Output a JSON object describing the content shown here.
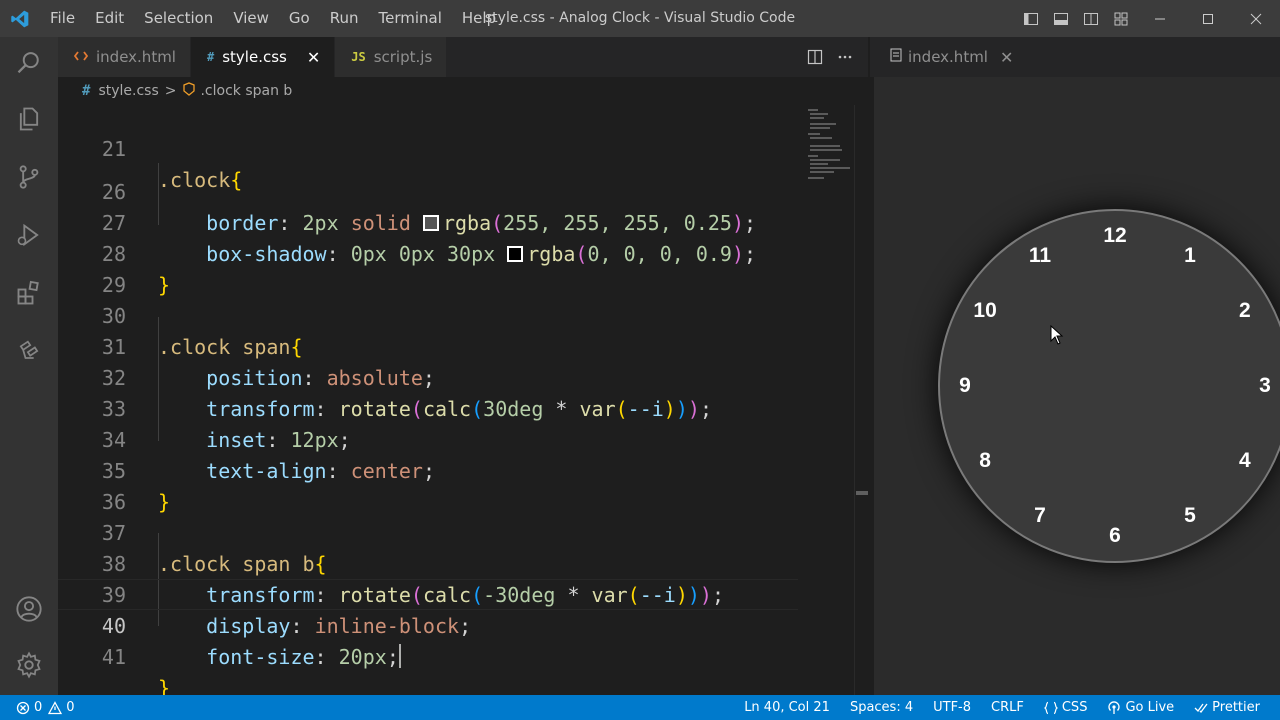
{
  "window": {
    "title": "style.css - Analog Clock - Visual Studio Code"
  },
  "menu": [
    "File",
    "Edit",
    "Selection",
    "View",
    "Go",
    "Run",
    "Terminal",
    "Help"
  ],
  "tabs": [
    {
      "label": "index.html",
      "icon": "html-file-icon",
      "active": false
    },
    {
      "label": "style.css",
      "icon": "css-file-icon",
      "active": true
    },
    {
      "label": "script.js",
      "icon": "js-file-icon",
      "active": false
    }
  ],
  "tab_icons": {
    "css": "#",
    "js": "JS"
  },
  "breadcrumb": {
    "file": "style.css",
    "separator": ">",
    "symbol": ".clock span b"
  },
  "editor": {
    "lines": [
      {
        "n": "21",
        "text": ".clock{"
      },
      {
        "n": "26",
        "text": "border: 2px solid rgba(255, 255, 255, 0.25);"
      },
      {
        "n": "27",
        "text": "box-shadow: 0px 0px 30px rgba(0, 0, 0, 0.9);"
      },
      {
        "n": "28",
        "text": "}"
      },
      {
        "n": "29",
        "text": ""
      },
      {
        "n": "30",
        "text": ".clock span{"
      },
      {
        "n": "31",
        "text": "position: absolute;"
      },
      {
        "n": "32",
        "text": "transform: rotate(calc(30deg * var(--i)));"
      },
      {
        "n": "33",
        "text": "inset: 12px;"
      },
      {
        "n": "34",
        "text": "text-align: center;"
      },
      {
        "n": "35",
        "text": "}"
      },
      {
        "n": "36",
        "text": ""
      },
      {
        "n": "37",
        "text": ".clock span b{"
      },
      {
        "n": "38",
        "text": "transform: rotate(calc(-30deg * var(--i)));"
      },
      {
        "n": "39",
        "text": "display: inline-block;"
      },
      {
        "n": "40",
        "text": "font-size: 20px;"
      },
      {
        "n": "41",
        "text": "}"
      }
    ],
    "current_line": "40",
    "tokens": {
      "l21_sel": ".clock",
      "l26_prop": "border",
      "l26_a": "2px",
      "l26_b": "solid",
      "l26_fn": "rgba",
      "l26_args": "255, 255, 255, 0.25",
      "l27_prop": "box-shadow",
      "l27_a": "0px 0px 30px",
      "l27_fn": "rgba",
      "l27_args": "0, 0, 0, 0.9",
      "l30_sel": ".clock span",
      "l31_prop": "position",
      "l31_val": "absolute",
      "l32_prop": "transform",
      "l32_fn1": "rotate",
      "l32_fn2": "calc",
      "l32_num": "30deg",
      "l32_op": " * ",
      "l32_fn3": "var",
      "l32_arg": "--i",
      "l33_prop": "inset",
      "l33_val": "12px",
      "l34_prop": "text-align",
      "l34_val": "center",
      "l37_sel": ".clock span b",
      "l38_prop": "transform",
      "l38_fn1": "rotate",
      "l38_fn2": "calc",
      "l38_num": "-30deg",
      "l38_op": " * ",
      "l38_fn3": "var",
      "l38_arg": "--i",
      "l39_prop": "display",
      "l39_val": "inline-block",
      "l40_prop": "font-size",
      "l40_val": "20px"
    }
  },
  "preview": {
    "tab_label": "index.html",
    "clock_numbers": [
      "12",
      "1",
      "2",
      "3",
      "4",
      "5",
      "6",
      "7",
      "8",
      "9",
      "10",
      "11"
    ]
  },
  "statusbar": {
    "errors": "0",
    "warnings": "0",
    "position": "Ln 40, Col 21",
    "spaces": "Spaces: 4",
    "encoding": "UTF-8",
    "eol": "CRLF",
    "language": "CSS",
    "go_live": "Go Live",
    "prettier": "Prettier"
  },
  "colors": {
    "accent": "#007acc",
    "titlebar": "#3c3c3c",
    "activitybar": "#333333",
    "editor_bg": "#1e1e1e",
    "selector": "#d7ba7d",
    "property": "#9cdcfe",
    "value": "#ce9178",
    "number": "#b5cea8",
    "function": "#dcdcaa"
  }
}
